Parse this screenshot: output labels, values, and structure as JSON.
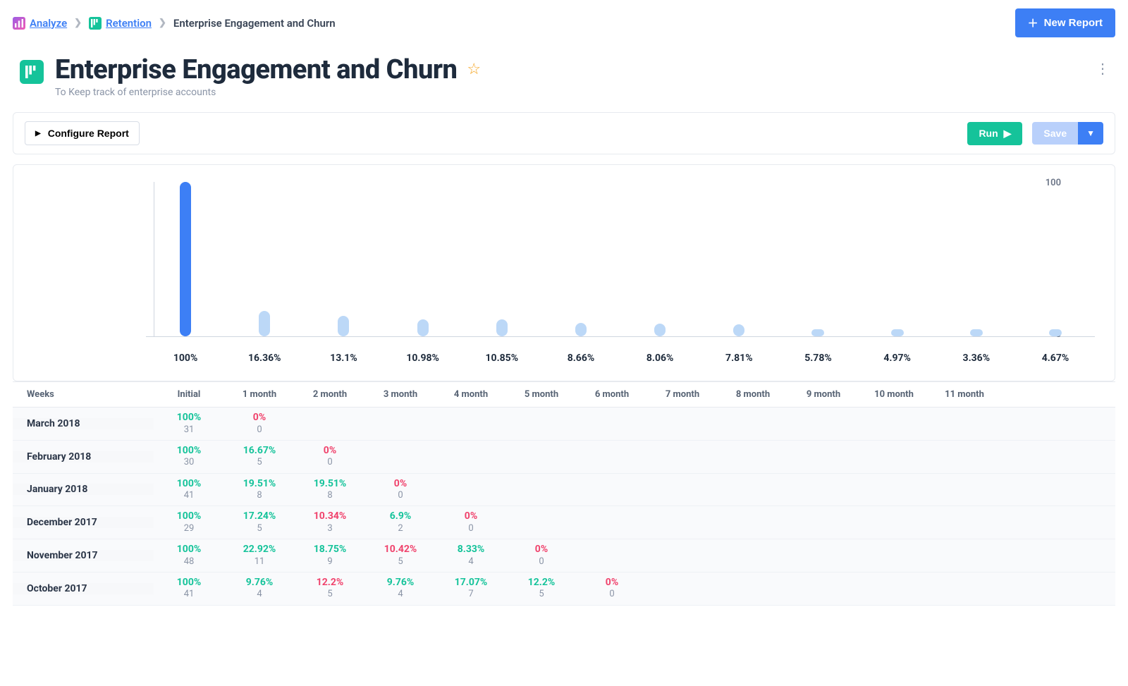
{
  "breadcrumbs": {
    "analyze": "Analyze",
    "retention": "Retention",
    "current": "Enterprise Engagement and Churn"
  },
  "buttons": {
    "new_report": "New Report",
    "configure": "Configure Report",
    "run": "Run",
    "save": "Save"
  },
  "header": {
    "title": "Enterprise Engagement and Churn",
    "subtitle": "To Keep track of enterprise accounts"
  },
  "chart_data": {
    "type": "bar",
    "ylabel": "",
    "ylim": [
      0,
      100
    ],
    "ytick_top": "100",
    "ytick_bottom": "0",
    "categories": [
      "100%",
      "16.36%",
      "13.1%",
      "10.98%",
      "10.85%",
      "8.66%",
      "8.06%",
      "7.81%",
      "5.78%",
      "4.97%",
      "3.36%",
      "4.67%"
    ],
    "values": [
      100,
      16.36,
      13.1,
      10.98,
      10.85,
      8.66,
      8.06,
      7.81,
      5.78,
      4.97,
      3.36,
      4.67
    ]
  },
  "table": {
    "row_header": "Weeks",
    "columns": [
      "Initial",
      "1 month",
      "2 month",
      "3 month",
      "4 month",
      "5 month",
      "6 month",
      "7 month",
      "8 month",
      "9 month",
      "10 month",
      "11 month"
    ],
    "rows": [
      {
        "label": "March 2018",
        "cells": [
          {
            "pct": "100%",
            "n": "31"
          },
          {
            "pct": "0%",
            "n": "0",
            "zero": true
          }
        ]
      },
      {
        "label": "February 2018",
        "cells": [
          {
            "pct": "100%",
            "n": "30"
          },
          {
            "pct": "16.67%",
            "n": "5"
          },
          {
            "pct": "0%",
            "n": "0",
            "zero": true
          }
        ]
      },
      {
        "label": "January 2018",
        "cells": [
          {
            "pct": "100%",
            "n": "41"
          },
          {
            "pct": "19.51%",
            "n": "8"
          },
          {
            "pct": "19.51%",
            "n": "8"
          },
          {
            "pct": "0%",
            "n": "0",
            "zero": true
          }
        ]
      },
      {
        "label": "December 2017",
        "cells": [
          {
            "pct": "100%",
            "n": "29"
          },
          {
            "pct": "17.24%",
            "n": "5"
          },
          {
            "pct": "10.34%",
            "n": "3",
            "zero": true
          },
          {
            "pct": "6.9%",
            "n": "2"
          },
          {
            "pct": "0%",
            "n": "0",
            "zero": true
          }
        ]
      },
      {
        "label": "November 2017",
        "cells": [
          {
            "pct": "100%",
            "n": "48"
          },
          {
            "pct": "22.92%",
            "n": "11"
          },
          {
            "pct": "18.75%",
            "n": "9"
          },
          {
            "pct": "10.42%",
            "n": "5",
            "zero": true
          },
          {
            "pct": "8.33%",
            "n": "4"
          },
          {
            "pct": "0%",
            "n": "0",
            "zero": true
          }
        ]
      },
      {
        "label": "October 2017",
        "cells": [
          {
            "pct": "100%",
            "n": "41"
          },
          {
            "pct": "9.76%",
            "n": "4"
          },
          {
            "pct": "12.2%",
            "n": "5",
            "zero": true
          },
          {
            "pct": "9.76%",
            "n": "4"
          },
          {
            "pct": "17.07%",
            "n": "7"
          },
          {
            "pct": "12.2%",
            "n": "5"
          },
          {
            "pct": "0%",
            "n": "0",
            "zero": true
          }
        ]
      }
    ]
  }
}
